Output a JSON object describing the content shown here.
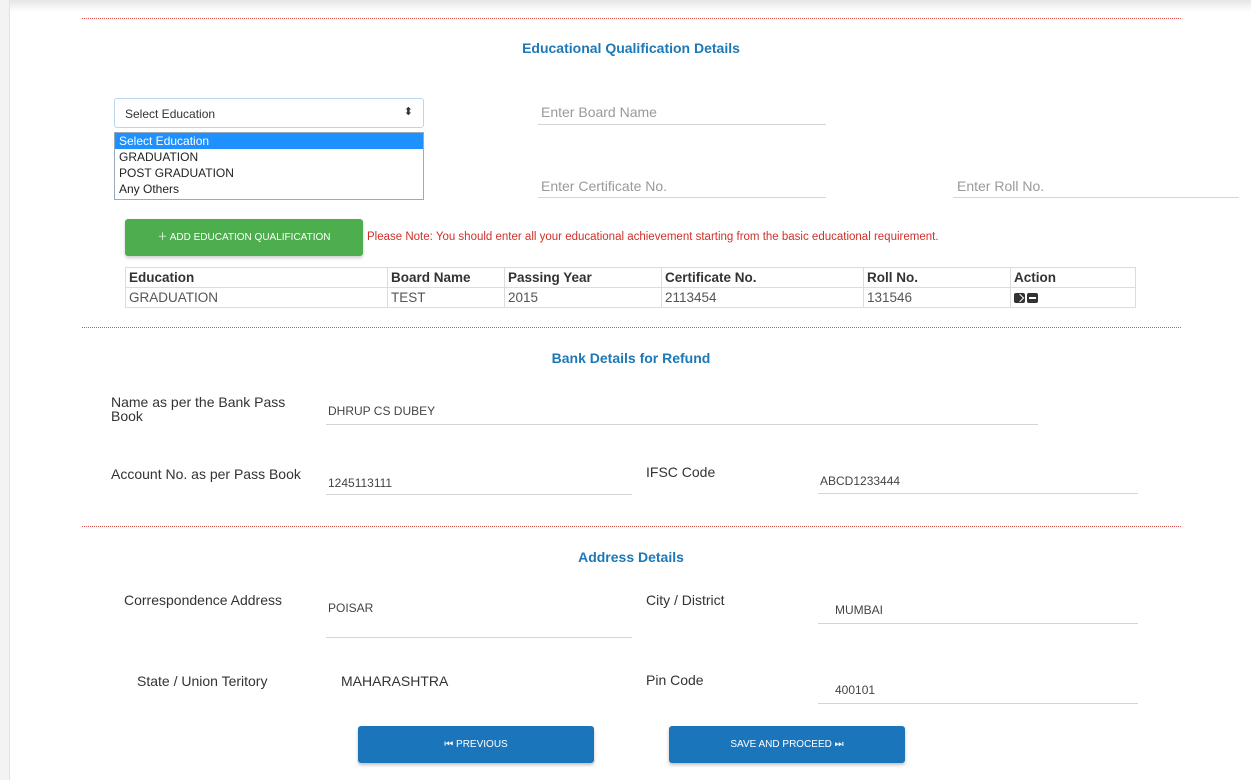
{
  "education": {
    "title": "Educational Qualification Details",
    "select": {
      "selected": "Select Education",
      "arrow": "⬍",
      "options": [
        "Select Education",
        "GRADUATION",
        "POST GRADUATION",
        "Any Others"
      ]
    },
    "board_placeholder": "Enter Board Name",
    "certificate_placeholder": "Enter Certificate No.",
    "roll_placeholder": "Enter Roll No.",
    "add_button": "＋ ADD EDUCATION QUALIFICATION",
    "note": "Please Note: You should enter all your educational achievement starting from the basic educational requirement.",
    "table": {
      "headers": [
        "Education",
        "Board Name",
        "Passing Year",
        "Certificate No.",
        "Roll No.",
        "Action"
      ],
      "rows": [
        {
          "education": "GRADUATION",
          "board": "TEST",
          "year": "2015",
          "certificate": "2113454",
          "roll": "131546"
        }
      ]
    }
  },
  "bank": {
    "title": "Bank Details for Refund",
    "name_label": "Name as per the Bank Pass Book",
    "name_value": "DHRUP CS DUBEY",
    "account_label": "Account No. as per Pass Book",
    "account_value": "1245113111",
    "ifsc_label": "IFSC Code",
    "ifsc_value": "ABCD1233444"
  },
  "address": {
    "title": "Address Details",
    "corr_label": "Correspondence Address",
    "corr_value": "POISAR",
    "city_label": "City / District",
    "city_value": "MUMBAI",
    "state_label": "State / Union Teritory",
    "state_value": "MAHARASHTRA",
    "pin_label": "Pin Code",
    "pin_value": "400101"
  },
  "buttons": {
    "previous": "⏮ PREVIOUS",
    "save": "SAVE AND PROCEED ⏭"
  },
  "colors": {
    "accent": "#1b75bb",
    "success": "#4cae4c",
    "warning_text": "#d0302a"
  }
}
